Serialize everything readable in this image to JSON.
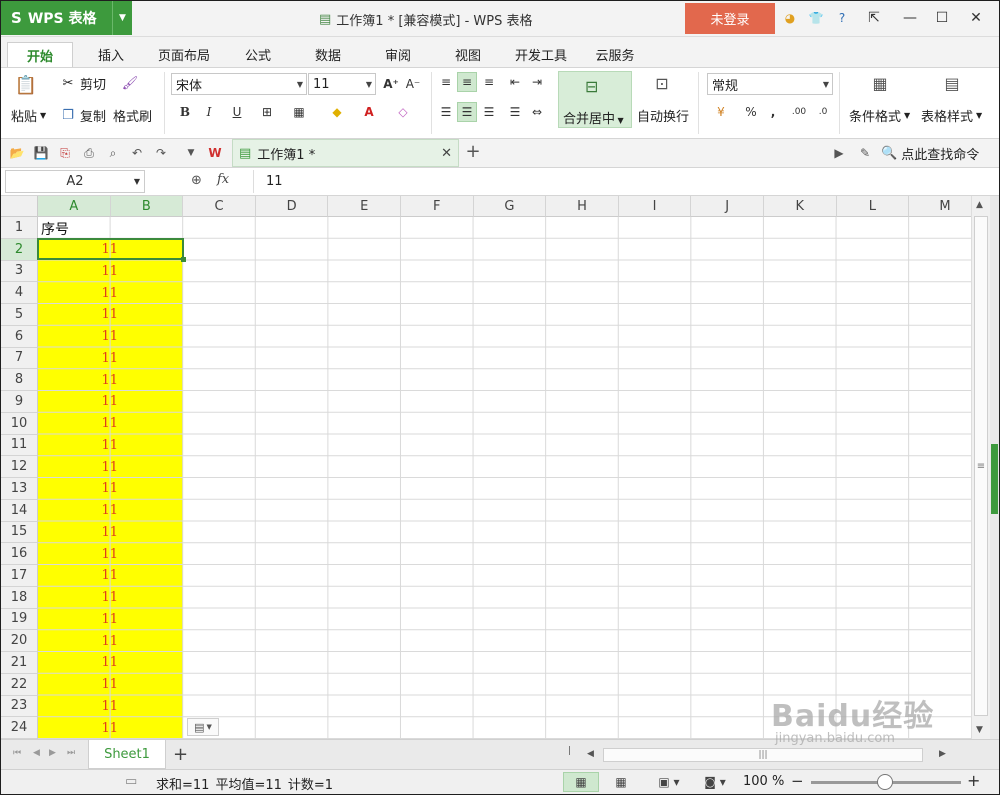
{
  "titlebar": {
    "app_name": "WPS 表格",
    "title": "工作簿1 * [兼容模式] - WPS 表格",
    "login": "未登录"
  },
  "tabs": [
    "开始",
    "插入",
    "页面布局",
    "公式",
    "数据",
    "审阅",
    "视图",
    "开发工具",
    "云服务"
  ],
  "ribbon": {
    "paste": "粘贴",
    "cut": "剪切",
    "copy": "复制",
    "format_painter": "格式刷",
    "font_name": "宋体",
    "font_size": "11",
    "bold": "B",
    "italic": "I",
    "underline": "U",
    "merge_center": "合并居中",
    "wrap_text": "自动换行",
    "number_format": "常规",
    "percent": "%",
    "comma": ",",
    "conditional_format": "条件格式",
    "table_style": "表格样式"
  },
  "doc_tab": {
    "label": "工作簿1 *"
  },
  "search_command": "点此查找命令",
  "formula_bar": {
    "name_box": "A2",
    "fx": "fx",
    "value": "11"
  },
  "columns": [
    "A",
    "B",
    "C",
    "D",
    "E",
    "F",
    "G",
    "H",
    "I",
    "J",
    "K",
    "L",
    "M"
  ],
  "rows": [
    "1",
    "2",
    "3",
    "4",
    "5",
    "6",
    "7",
    "8",
    "9",
    "10",
    "11",
    "12",
    "13",
    "14",
    "15",
    "16",
    "17",
    "18",
    "19",
    "20",
    "21",
    "22",
    "23",
    "24"
  ],
  "cells": {
    "A1": "序号",
    "value": "11"
  },
  "sheet_tab": "Sheet1",
  "status": {
    "sum": "求和=11",
    "avg": "平均值=11",
    "count": "计数=1",
    "zoom": "100 %"
  },
  "watermark": {
    "big": "Baidu经验",
    "small": "jingyan.baidu.com"
  },
  "colors": {
    "accent": "#3d9a3d",
    "fill": "#ffff00",
    "value_text": "#e03c1c",
    "login": "#e2684d"
  }
}
